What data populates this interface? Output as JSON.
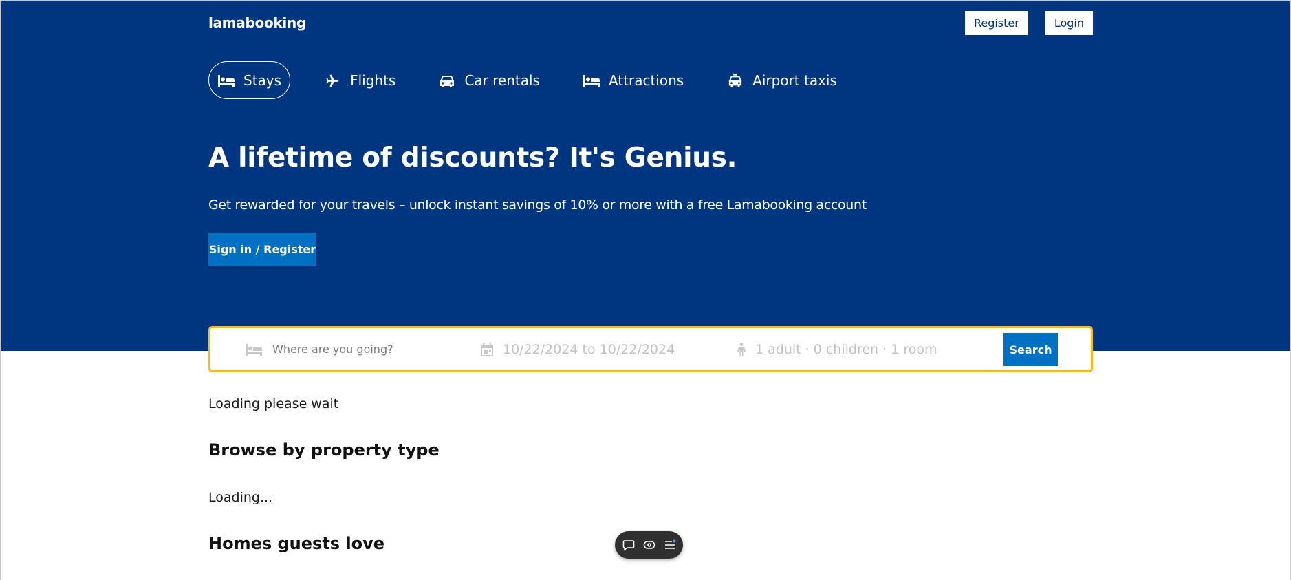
{
  "navbar": {
    "logo": "lamabooking",
    "register_label": "Register",
    "login_label": "Login"
  },
  "header_tabs": [
    {
      "label": "Stays",
      "icon": "bed-icon",
      "active": true
    },
    {
      "label": "Flights",
      "icon": "plane-icon",
      "active": false
    },
    {
      "label": "Car rentals",
      "icon": "car-icon",
      "active": false
    },
    {
      "label": "Attractions",
      "icon": "bed-icon",
      "active": false
    },
    {
      "label": "Airport taxis",
      "icon": "taxi-icon",
      "active": false
    }
  ],
  "hero": {
    "title": "A lifetime of discounts? It's Genius.",
    "description": "Get rewarded for your travels – unlock instant savings of 10% or more with a free Lamabooking account",
    "button_label": "Sign in / Register"
  },
  "search": {
    "destination_placeholder": "Where are you going?",
    "dates": "10/22/2024 to 10/22/2024",
    "guests": "1 adult · 0 children · 1 room",
    "button_label": "Search"
  },
  "content": {
    "loading_text": "Loading please wait",
    "property_type_title": "Browse by property type",
    "property_loading_text": "Loading...",
    "homes_title": "Homes guests love"
  },
  "colors": {
    "primary": "#003580",
    "button_blue": "#0071c2",
    "search_border": "#febb02"
  }
}
